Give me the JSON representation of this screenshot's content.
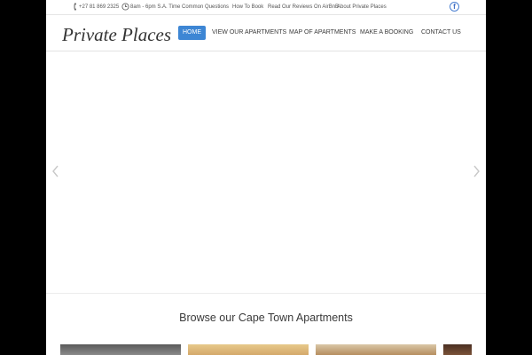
{
  "topbar": {
    "phone": "+27 81 869 2325",
    "hours": "8am - 6pm S.A. Time",
    "links": [
      "Common Questions",
      "How To Book",
      "Read Our Reviews On AirBnB",
      "About Private Places"
    ],
    "facebook": "f"
  },
  "header": {
    "logo": "Private Places",
    "nav": [
      "HOME",
      "VIEW OUR APARTMENTS",
      "MAP OF APARTMENTS",
      "MAKE A BOOKING",
      "CONTACT US"
    ],
    "active_index": 0
  },
  "slider": {
    "prev_icon": "chevron-left-icon",
    "next_icon": "chevron-right-icon"
  },
  "browse": {
    "title": "Browse our Cape Town Apartments"
  },
  "colors": {
    "accent": "#3d86d4",
    "facebook": "#3b6bc4"
  }
}
